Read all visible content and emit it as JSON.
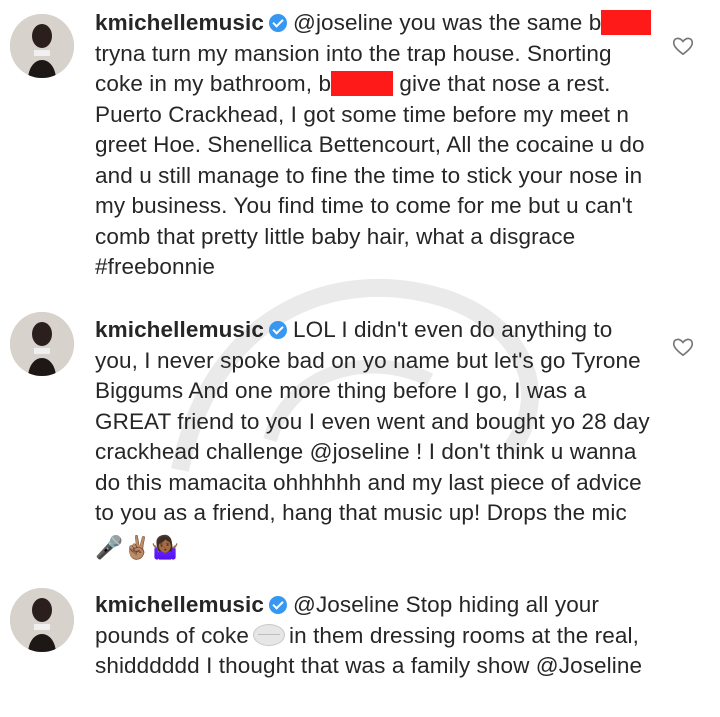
{
  "comments": [
    {
      "username": "kmichellemusic",
      "text": [
        "@joseline you was the same ",
        " tryna turn my mansion into the trap house. Snorting coke in my bathroom, ",
        " give that nose a rest. Puerto Crackhead, I got some time before my meet n greet Hoe. Shenellica Bettencourt, All the cocaine u do and u still manage to fine the time to stick your nose in my business. You find time to come for me but u can't comb that pretty little baby hair, what a disgrace #freebonnie"
      ],
      "redacted_prefix": "b"
    },
    {
      "username": "kmichellemusic",
      "text": "LOL I didn't even do anything to you, I never spoke bad on yo name but let's go Tyrone Biggums And one more thing before I go, I was a GREAT friend to you I even went and bought yo 28 day crackhead challenge @joseline ! I don't think u wanna do this mamacita ohhhhhh and my last piece of advice to you as a friend, hang that music up! Drops the mic",
      "emojis": "🎤✌🏽🤷🏾‍♀️"
    },
    {
      "username": "kmichellemusic",
      "text_before": "@Joseline Stop hiding all your pounds of coke",
      "text_after": "in them dressing rooms at the real, shidddddd I thought that was a family show @Joseline"
    }
  ],
  "icons": {
    "verified": "verified-badge-icon",
    "like": "heart-outline-icon",
    "pill": "pill-emoji-icon"
  },
  "colors": {
    "verified": "#3897f0",
    "redaction": "#ff1a1a",
    "text": "#262626"
  }
}
